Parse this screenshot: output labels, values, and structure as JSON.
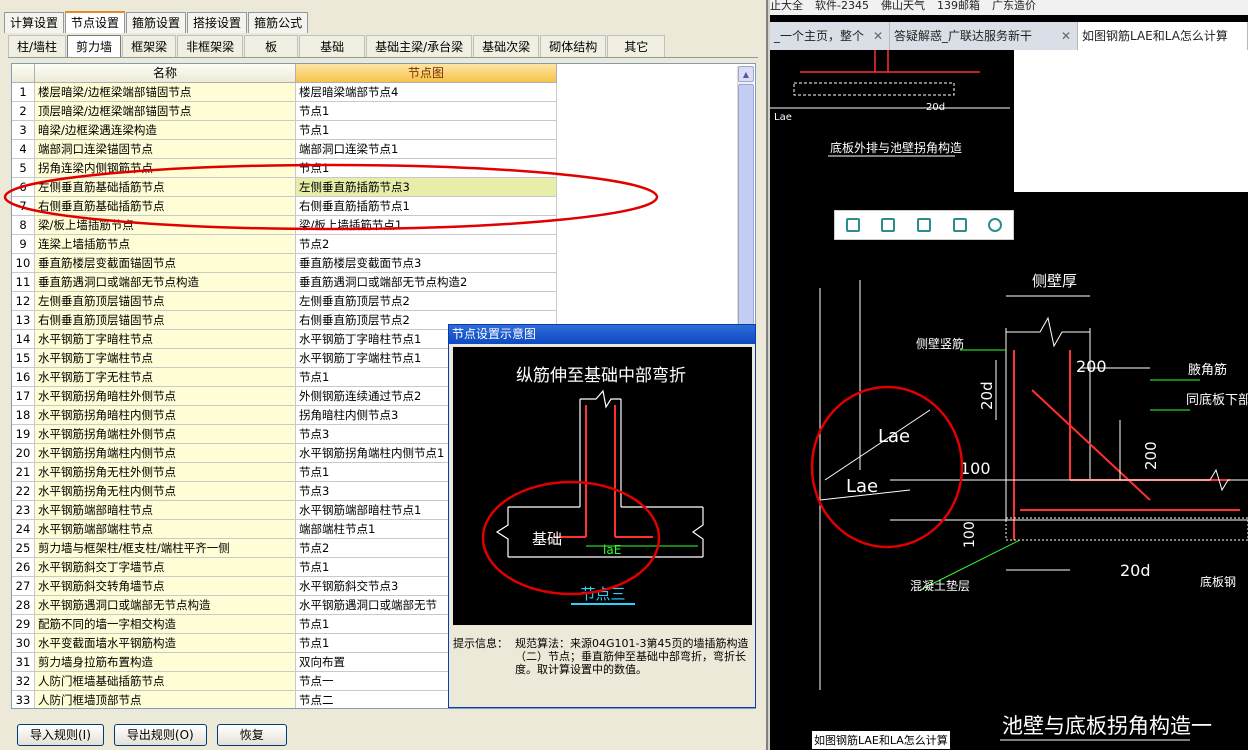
{
  "tabs": [
    "计算设置",
    "节点设置",
    "箍筋设置",
    "搭接设置",
    "箍筋公式"
  ],
  "subtabs": [
    "柱/墙柱",
    "剪力墙",
    "框架梁",
    "非框架梁",
    "板",
    "基础",
    "基础主梁/承台梁",
    "基础次梁",
    "砌体结构",
    "其它"
  ],
  "grid": {
    "header_name": "名称",
    "header_node": "节点图",
    "rows": [
      {
        "n": "1",
        "name": "楼层暗梁/边框梁端部锚固节点",
        "node": "楼层暗梁端部节点4"
      },
      {
        "n": "2",
        "name": "顶层暗梁/边框梁端部锚固节点",
        "node": "节点1"
      },
      {
        "n": "3",
        "name": "暗梁/边框梁遇连梁构造",
        "node": "节点1"
      },
      {
        "n": "4",
        "name": "端部洞口连梁锚固节点",
        "node": "端部洞口连梁节点1"
      },
      {
        "n": "5",
        "name": "拐角连梁内侧钢筋节点",
        "node": "节点1"
      },
      {
        "n": "6",
        "name": "左侧垂直筋基础插筋节点",
        "node": "左侧垂直筋插筋节点3"
      },
      {
        "n": "7",
        "name": "右侧垂直筋基础插筋节点",
        "node": "右侧垂直筋插筋节点1"
      },
      {
        "n": "8",
        "name": "梁/板上墙插筋节点",
        "node": "梁/板上墙插筋节点1"
      },
      {
        "n": "9",
        "name": "连梁上墙插筋节点",
        "node": "节点2"
      },
      {
        "n": "10",
        "name": "垂直筋楼层变截面锚固节点",
        "node": "垂直筋楼层变截面节点3"
      },
      {
        "n": "11",
        "name": "垂直筋遇洞口或端部无节点构造",
        "node": "垂直筋遇洞口或端部无节点构造2"
      },
      {
        "n": "12",
        "name": "左侧垂直筋顶层锚固节点",
        "node": "左侧垂直筋顶层节点2"
      },
      {
        "n": "13",
        "name": "右侧垂直筋顶层锚固节点",
        "node": "右侧垂直筋顶层节点2"
      },
      {
        "n": "14",
        "name": "水平钢筋丁字暗柱节点",
        "node": "水平钢筋丁字暗柱节点1"
      },
      {
        "n": "15",
        "name": "水平钢筋丁字端柱节点",
        "node": "水平钢筋丁字端柱节点1"
      },
      {
        "n": "16",
        "name": "水平钢筋丁字无柱节点",
        "node": "节点1"
      },
      {
        "n": "17",
        "name": "水平钢筋拐角暗柱外侧节点",
        "node": "外侧钢筋连续通过节点2"
      },
      {
        "n": "18",
        "name": "水平钢筋拐角暗柱内侧节点",
        "node": "拐角暗柱内侧节点3"
      },
      {
        "n": "19",
        "name": "水平钢筋拐角端柱外侧节点",
        "node": "节点3"
      },
      {
        "n": "20",
        "name": "水平钢筋拐角端柱内侧节点",
        "node": "水平钢筋拐角端柱内侧节点1"
      },
      {
        "n": "21",
        "name": "水平钢筋拐角无柱外侧节点",
        "node": "节点1"
      },
      {
        "n": "22",
        "name": "水平钢筋拐角无柱内侧节点",
        "node": "节点3"
      },
      {
        "n": "23",
        "name": "水平钢筋端部暗柱节点",
        "node": "水平钢筋端部暗柱节点1"
      },
      {
        "n": "24",
        "name": "水平钢筋端部端柱节点",
        "node": "端部端柱节点1"
      },
      {
        "n": "25",
        "name": "剪力墙与框架柱/框支柱/端柱平齐一侧",
        "node": "节点2"
      },
      {
        "n": "26",
        "name": "水平钢筋斜交丁字墙节点",
        "node": "节点1"
      },
      {
        "n": "27",
        "name": "水平钢筋斜交转角墙节点",
        "node": "水平钢筋斜交节点3"
      },
      {
        "n": "28",
        "name": "水平钢筋遇洞口或端部无节点构造",
        "node": "水平钢筋遇洞口或端部无节"
      },
      {
        "n": "29",
        "name": "配筋不同的墙一字相交构造",
        "node": "节点1"
      },
      {
        "n": "30",
        "name": "水平变截面墙水平钢筋构造",
        "node": "节点1"
      },
      {
        "n": "31",
        "name": "剪力墙身拉筋布置构造",
        "node": "双向布置"
      },
      {
        "n": "32",
        "name": "人防门框墙基础插筋节点",
        "node": "节点一"
      },
      {
        "n": "33",
        "name": "人防门框墙顶部节点",
        "node": "节点二"
      }
    ]
  },
  "buttons": {
    "import": "导入规则(I)",
    "export": "导出规则(O)",
    "restore": "恢复"
  },
  "popup": {
    "title": "节点设置示意图",
    "diagram_title": "纵筋伸至基础中部弯折",
    "foundation": "基础",
    "lae": "laE",
    "node_label": "节点三",
    "hint_label": "提示信息：",
    "hint_text": "规范算法：来源04G101-3第45页的墙插筋构造（二）节点；垂直筋伸至基础中部弯折，弯折长度。取计算设置中的数值。"
  },
  "browser": {
    "bookmarks": [
      "止大全",
      "软件-2345",
      "佛山天气",
      "139邮箱",
      "广东造价"
    ],
    "tabs": [
      {
        "label": "_一个主页，整个"
      },
      {
        "label": "答疑解惑_广联达服务新干"
      },
      {
        "label": "如图钢筋LAE和LA怎么计算"
      }
    ],
    "caption": "如图钢筋LAE和LA怎么计算",
    "cad": {
      "top_title": "底板外排与池壁拐角构造",
      "lae_small": "Lae",
      "dim_20d_top": "20d",
      "wall_thick": "侧壁厚",
      "side_rebar": "侧壁竖筋",
      "d200a": "200",
      "d20d_left": "20d",
      "d200b": "200",
      "d100a": "100",
      "d100b": "100",
      "lae1": "Lae",
      "lae2": "Lae",
      "d20d_bottom": "20d",
      "note1": "腋角筋",
      "note2": "同底板下部钢",
      "cushion": "混凝土垫层",
      "bottom_rebar": "底板钢",
      "title": "池壁与底板拐角构造一"
    }
  },
  "colors": {
    "accent": "#e68b2c",
    "title_bar": "#0b4ac2",
    "highlight_row": "#e8eeaa",
    "annotation": "#e00000"
  }
}
